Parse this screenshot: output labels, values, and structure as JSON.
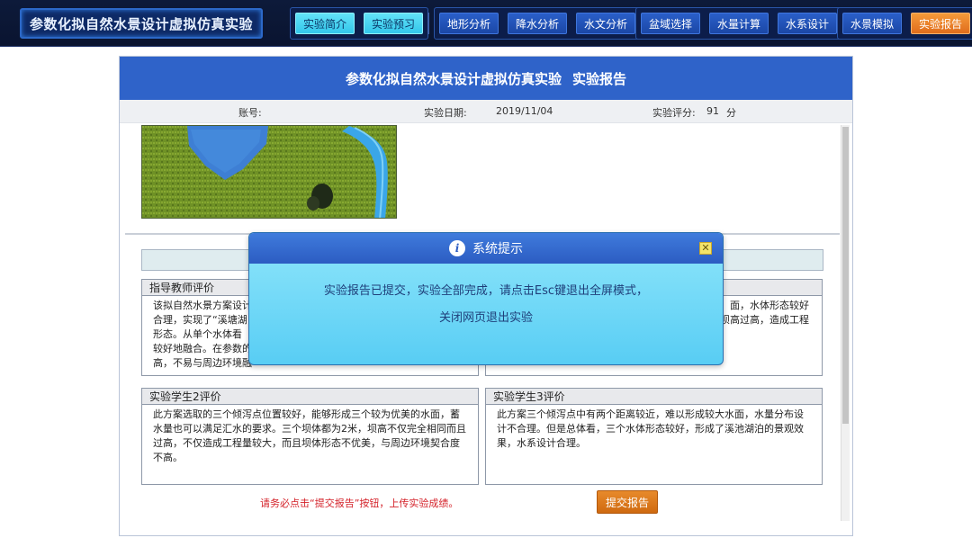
{
  "app": {
    "title": "参数化拟自然水景设计虚拟仿真实验"
  },
  "nav": {
    "group1": [
      "实验简介",
      "实验预习"
    ],
    "group2": [
      "地形分析",
      "降水分析",
      "水文分析"
    ],
    "group3": [
      "盆域选择",
      "水量计算",
      "水系设计"
    ],
    "group4": [
      "水景模拟",
      "实验报告"
    ]
  },
  "report": {
    "title": "参数化拟自然水景设计虚拟仿真实验",
    "subtitle": "实验报告",
    "account_label": "账号:",
    "date_label": "实验日期:",
    "date_value": "2019/11/04",
    "score_label": "实验评分:",
    "score_value": "91",
    "score_unit": "分"
  },
  "evaluations": {
    "teacher": {
      "title": "指导教师评价",
      "lines": [
        "该拟自然水景方案设计",
        "合理，实现了“溪塘湖",
        "形态。从单个水体看",
        "较好地融合。在参数的",
        "高，不易与周边环境融"
      ]
    },
    "student1": {
      "lines": [
        "面，水体形态较好",
        "坝高过高，造成工程"
      ]
    },
    "student2": {
      "title": "实验学生2评价",
      "text": "此方案选取的三个倾泻点位置较好，能够形成三个较为优美的水面，蓄水量也可以满足汇水的要求。三个坝体都为2米，坝高不仅完全相同而且过高，不仅造成工程量较大，而且坝体形态不优美，与周边环境契合度不高。"
    },
    "student3": {
      "title": "实验学生3评价",
      "text": "此方案三个倾泻点中有两个距离较近，难以形成较大水面，水量分布设计不合理。但是总体看，三个水体形态较好，形成了溪池湖泊的景观效果，水系设计合理。"
    }
  },
  "footer": {
    "note": "请务必点击“提交报告”按钮，上传实验成绩。",
    "submit_label": "提交报告"
  },
  "modal": {
    "title": "系统提示",
    "line1": "实验报告已提交，实验全部完成，请点击Esc键退出全屏模式，",
    "line2": "关闭网页退出实验"
  },
  "colors": {
    "header_blue": "#2f63c9",
    "accent_orange": "#e06d1c",
    "accent_cyan": "#33c6ea",
    "note_red": "#d4222a"
  }
}
